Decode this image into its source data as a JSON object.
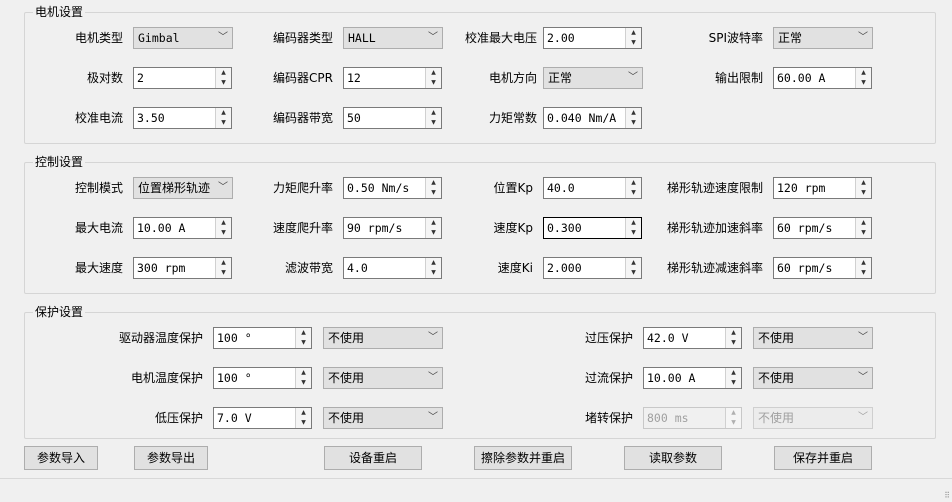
{
  "motor": {
    "title": "电机设置",
    "motor_type": {
      "label": "电机类型",
      "value": "Gimbal"
    },
    "encoder_type": {
      "label": "编码器类型",
      "value": "HALL"
    },
    "calib_max_voltage": {
      "label": "校准最大电压",
      "value": "2.00"
    },
    "spi_baud": {
      "label": "SPI波特率",
      "value": "正常"
    },
    "pole_pairs": {
      "label": "极对数",
      "value": "2"
    },
    "encoder_cpr": {
      "label": "编码器CPR",
      "value": "12"
    },
    "motor_direction": {
      "label": "电机方向",
      "value": "正常"
    },
    "output_limit": {
      "label": "输出限制",
      "value": "60.00 A"
    },
    "calib_current": {
      "label": "校准电流",
      "value": "3.50"
    },
    "encoder_bandwidth": {
      "label": "编码器带宽",
      "value": "50"
    },
    "torque_constant": {
      "label": "力矩常数",
      "value": "0.040 Nm/A"
    }
  },
  "control": {
    "title": "控制设置",
    "control_mode": {
      "label": "控制模式",
      "value": "位置梯形轨迹"
    },
    "torque_ramp": {
      "label": "力矩爬升率",
      "value": "0.50 Nm/s"
    },
    "pos_kp": {
      "label": "位置Kp",
      "value": "40.0"
    },
    "traj_vel_limit": {
      "label": "梯形轨迹速度限制",
      "value": "120 rpm"
    },
    "max_current": {
      "label": "最大电流",
      "value": "10.00 A"
    },
    "vel_ramp": {
      "label": "速度爬升率",
      "value": "90 rpm/s"
    },
    "vel_kp": {
      "label": "速度Kp",
      "value": "0.300"
    },
    "traj_accel": {
      "label": "梯形轨迹加速斜率",
      "value": "60 rpm/s"
    },
    "max_speed": {
      "label": "最大速度",
      "value": "300 rpm"
    },
    "filter_bandwidth": {
      "label": "滤波带宽",
      "value": "4.0"
    },
    "vel_ki": {
      "label": "速度Ki",
      "value": "2.000"
    },
    "traj_decel": {
      "label": "梯形轨迹减速斜率",
      "value": "60 rpm/s"
    }
  },
  "protect": {
    "title": "保护设置",
    "driver_temp": {
      "label": "驱动器温度保护",
      "value": "100 °",
      "mode": "不使用"
    },
    "overvoltage": {
      "label": "过压保护",
      "value": "42.0 V",
      "mode": "不使用"
    },
    "motor_temp": {
      "label": "电机温度保护",
      "value": "100 °",
      "mode": "不使用"
    },
    "overcurrent": {
      "label": "过流保护",
      "value": "10.00 A",
      "mode": "不使用"
    },
    "undervoltage": {
      "label": "低压保护",
      "value": "7.0 V",
      "mode": "不使用"
    },
    "stall": {
      "label": "堵转保护",
      "value": "800 ms",
      "mode": "不使用"
    }
  },
  "buttons": {
    "import": "参数导入",
    "export": "参数导出",
    "restart": "设备重启",
    "erase_restart": "擦除参数并重启",
    "read": "读取参数",
    "save_restart": "保存并重启"
  },
  "icons": {
    "spin_up": "▲",
    "spin_down": "▼",
    "dropdown": "chevron-down-icon",
    "dropdown_glyph": "﹀",
    "grip_glyph": "⠿"
  }
}
